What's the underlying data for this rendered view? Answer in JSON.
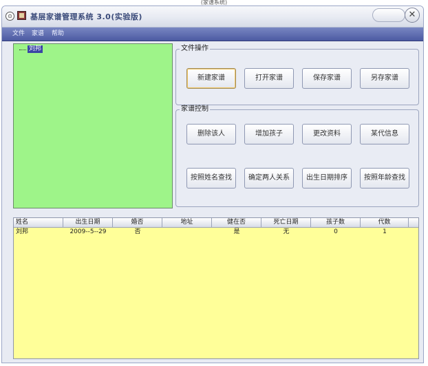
{
  "caption": "(家谱系统)",
  "window": {
    "title": "基层家谱管理系统 3.0(实验版)",
    "close_glyph": "✕"
  },
  "menu": [
    "文件",
    "家谱",
    "帮助"
  ],
  "tree": {
    "root": "刘邦"
  },
  "file_group": {
    "legend": "文件操作",
    "buttons": [
      "新建家谱",
      "打开家谱",
      "保存家谱",
      "另存家谱"
    ]
  },
  "control_group": {
    "legend": "家谱控制",
    "buttons_row1": [
      "删除该人",
      "增加孩子",
      "更改资料",
      "某代信息"
    ],
    "buttons_row2": [
      "按照姓名查找",
      "确定两人关系",
      "出生日期排序",
      "按照年龄查找"
    ]
  },
  "table": {
    "columns": [
      "姓名",
      "出生日期",
      "婚否",
      "地址",
      "健在否",
      "死亡日期",
      "孩子数",
      "代数"
    ],
    "rows": [
      [
        "刘邦",
        "2009--5--29",
        "否",
        "",
        "是",
        "无",
        "0",
        "1"
      ]
    ]
  },
  "colors": {
    "tree_bg": "#9ef489",
    "grid_bg": "#ffff99",
    "menubar": "#4c5aa2"
  }
}
